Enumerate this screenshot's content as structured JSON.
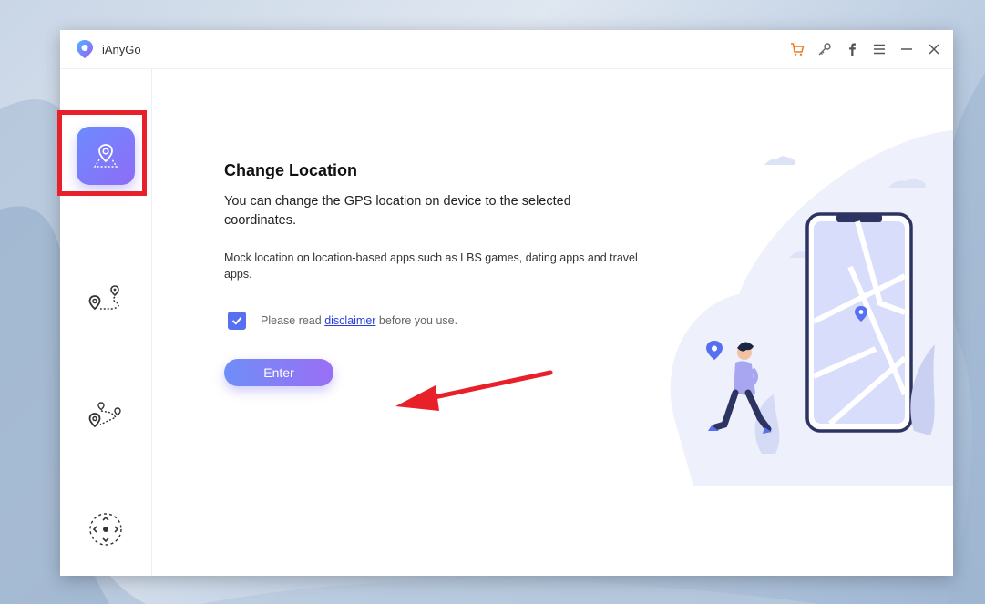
{
  "window": {
    "title": "iAnyGo"
  },
  "titlebar_icons": [
    "cart-icon",
    "key-icon",
    "facebook-icon",
    "menu-icon",
    "minimize-icon",
    "close-icon"
  ],
  "sidebar": {
    "items": [
      {
        "name": "change-location",
        "icon": "map-pin-area-icon",
        "active": true
      },
      {
        "name": "two-spot-movement",
        "icon": "two-pins-route-icon",
        "active": false
      },
      {
        "name": "multi-spot-movement",
        "icon": "multi-pins-route-icon",
        "active": false
      },
      {
        "name": "joystick-movement",
        "icon": "joystick-icon",
        "active": false
      }
    ]
  },
  "main": {
    "heading": "Change Location",
    "description": "You can change the GPS location on device to the selected coordinates.",
    "subdescription": "Mock location on location-based apps such as LBS games, dating apps and travel apps.",
    "disclaimer": {
      "checked": true,
      "prefix": "Please read ",
      "link": "disclaimer",
      "suffix": " before you use."
    },
    "enter_label": "Enter"
  },
  "colors": {
    "accent": "#5770f2",
    "accent_purple": "#9a6ff3",
    "highlight_red": "#e8202a",
    "cart_orange": "#f07a1a"
  }
}
